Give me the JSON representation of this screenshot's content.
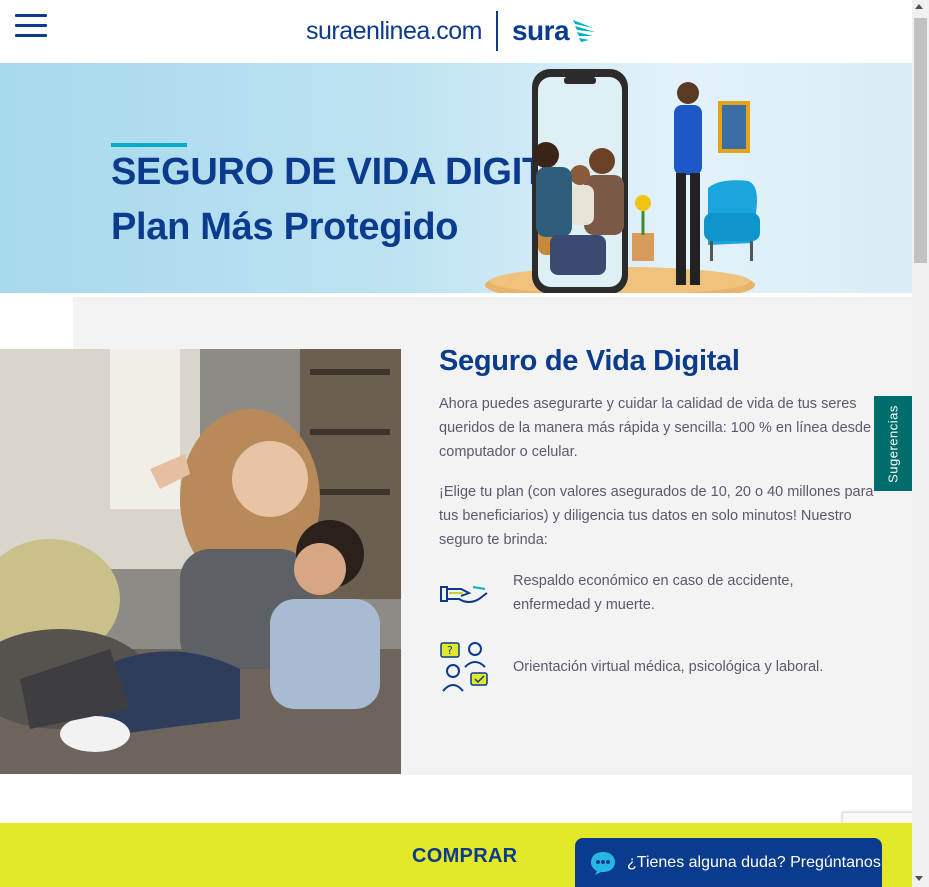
{
  "header": {
    "logo_domain": "suraenlinea.com",
    "logo_brand": "sura"
  },
  "hero": {
    "title": "SEGURO DE VIDA DIGITAL",
    "subtitle": "Plan Más Protegido"
  },
  "content": {
    "heading": "Seguro de Vida Digital",
    "paragraph1": "Ahora puedes asegurarte y cuidar la calidad de vida de tus seres queridos de la manera más rápida y sencilla: 100 % en línea desde tu computador o celular.",
    "paragraph2": "¡Elige tu plan (con valores asegurados de 10, 20 o 40 millones para tus beneficiarios) y diligencia tus datos en solo minutos! Nuestro seguro te brinda:",
    "benefits": [
      {
        "icon": "hand-coin-icon",
        "text": "Respaldo económico en caso de accidente, enfermedad y muerte."
      },
      {
        "icon": "medical-consult-icon",
        "text": "Orientación virtual médica, psicológica y laboral."
      }
    ]
  },
  "side_tab": {
    "label": "Sugerencias"
  },
  "cta": {
    "buy_label": "COMPRAR"
  },
  "chat": {
    "label": "¿Tienes alguna duda? Pregúntanos"
  },
  "colors": {
    "brand_blue": "#0b3b8c",
    "accent_cyan": "#00aec7",
    "cta_yellow": "#e3e829",
    "side_tab_teal": "#006d6d"
  }
}
